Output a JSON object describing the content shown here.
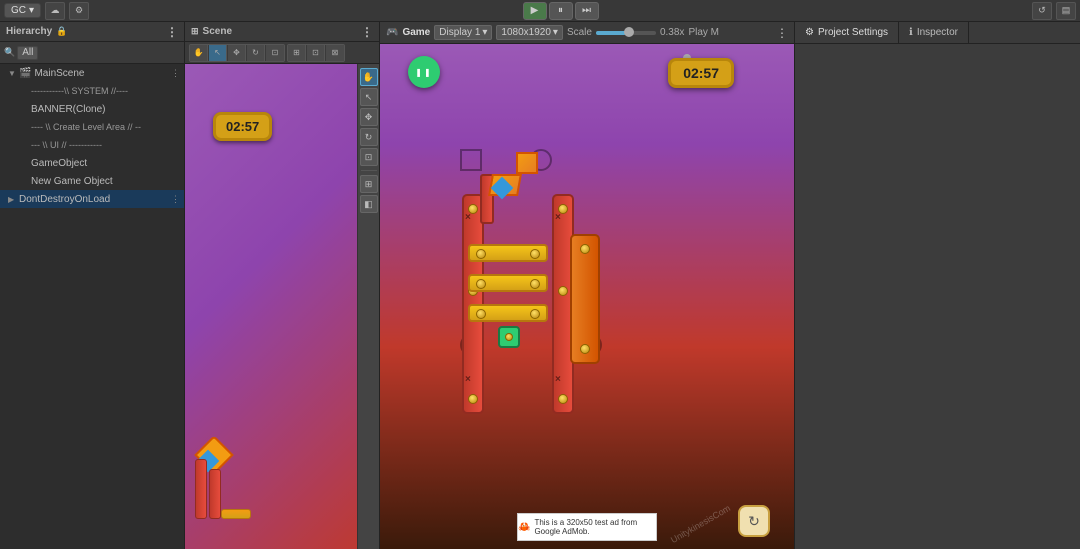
{
  "topbar": {
    "gc_label": "GC",
    "play_label": "▶",
    "pause_label": "⏸",
    "step_label": "⏭",
    "cloud_icon": "☁",
    "settings_icon": "⚙",
    "undo_icon": "↺",
    "layers_icon": "▤",
    "project_settings_label": "Project Settings",
    "inspector_label": "Inspector",
    "info_icon": "ℹ"
  },
  "hierarchy": {
    "title": "Hierarchy",
    "search_placeholder": "All",
    "items": [
      {
        "label": "MainScene",
        "indent": 0,
        "has_arrow": true,
        "icon": "🎬",
        "has_dots": true
      },
      {
        "label": "-----------\\\\ SYSTEM //----",
        "indent": 1,
        "has_arrow": false,
        "icon": ""
      },
      {
        "label": "BANNER(Clone)",
        "indent": 1,
        "has_arrow": false,
        "icon": ""
      },
      {
        "label": "---- \\\\ Create Level Area // --",
        "indent": 1,
        "has_arrow": false,
        "icon": ""
      },
      {
        "label": "--- \\\\ UI // -----------",
        "indent": 1,
        "has_arrow": false,
        "icon": ""
      },
      {
        "label": "GameObject",
        "indent": 1,
        "has_arrow": false,
        "icon": ""
      },
      {
        "label": "New Game Object",
        "indent": 1,
        "has_arrow": false,
        "icon": ""
      },
      {
        "label": "DontDestroyOnLoad",
        "indent": 0,
        "has_arrow": true,
        "icon": "",
        "selected": true,
        "has_dots": true
      }
    ]
  },
  "scene": {
    "title": "Scene",
    "timer_value": "02:57"
  },
  "game": {
    "title": "Game",
    "display_label": "Display 1",
    "resolution_label": "1080x1920",
    "scale_label": "Scale",
    "scale_value": "0.38x",
    "play_label": "Play M",
    "timer_value": "02:57",
    "ad_text": "This is a 320x50 test ad from Google AdMob.",
    "watermark": "UnitykinesisCom"
  },
  "inspector": {
    "title": "Inspector"
  },
  "project_settings": {
    "title": "Project Settings"
  }
}
